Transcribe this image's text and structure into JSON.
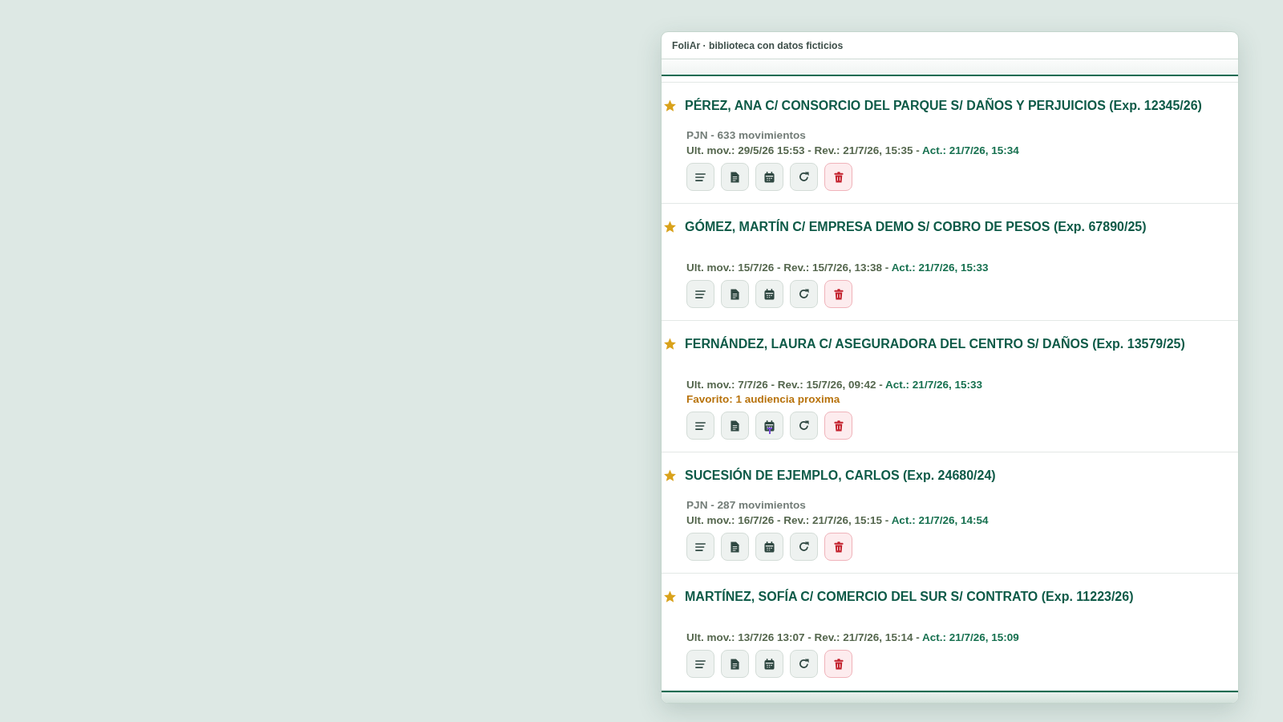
{
  "window": {
    "title": "FoliAr · biblioteca con datos ficticios"
  },
  "cases": [
    {
      "title": "PÉREZ, ANA C/ CONSORCIO DEL PARQUE S/ DAÑOS Y PERJUICIOS (Exp. 12345/26)",
      "favorite": true,
      "summary": "PJN - 633 movimientos",
      "dates": "Ult. mov.: 29/5/26 15:53 - Rev.: 21/7/26, 15:35 -",
      "updated": "Act.: 21/7/26, 15:34",
      "calendar_flag": false
    },
    {
      "title": "GÓMEZ, MARTÍN C/ EMPRESA DEMO S/ COBRO DE PESOS (Exp. 67890/25)",
      "favorite": true,
      "dates": "Ult. mov.: 15/7/26 - Rev.: 15/7/26, 13:38 -",
      "updated": "Act.: 21/7/26, 15:33",
      "calendar_flag": false
    },
    {
      "title": "FERNÁNDEZ, LAURA C/ ASEGURADORA DEL CENTRO S/ DAÑOS (Exp. 13579/25)",
      "favorite": true,
      "dates": "Ult. mov.: 7/7/26 - Rev.: 15/7/26, 09:42 -",
      "updated": "Act.: 21/7/26, 15:33",
      "note": "Favorito: 1 audiencia proxima",
      "calendar_flag": true
    },
    {
      "title": "SUCESIÓN DE EJEMPLO, CARLOS (Exp. 24680/24)",
      "favorite": true,
      "summary": "PJN - 287 movimientos",
      "dates": "Ult. mov.: 16/7/26 - Rev.: 21/7/26, 15:15 -",
      "updated": "Act.: 21/7/26, 14:54",
      "calendar_flag": false
    },
    {
      "title": "MARTÍNEZ, SOFÍA C/ COMERCIO DEL SUR S/ CONTRATO (Exp. 11223/26)",
      "favorite": true,
      "dates": "Ult. mov.: 13/7/26 13:07 - Rev.: 21/7/26, 15:14 -",
      "updated": "Act.: 21/7/26, 15:09",
      "calendar_flag": false
    }
  ]
}
